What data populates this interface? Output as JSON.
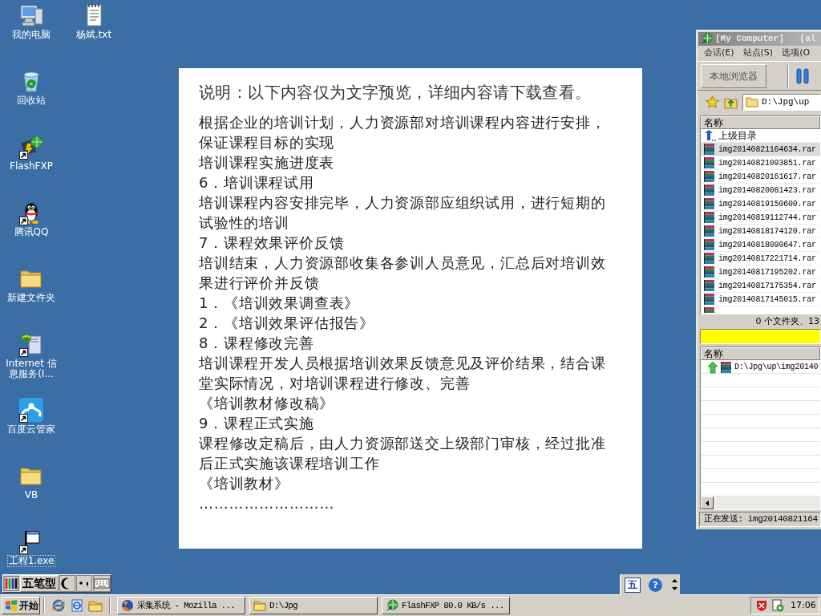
{
  "desktop": {
    "icons": [
      {
        "label": "我的电脑",
        "kind": "computer",
        "shortcut": false,
        "focused": false
      },
      {
        "label": "回收站",
        "kind": "recycle_bin",
        "shortcut": false,
        "focused": false
      },
      {
        "label": "FlashFXP",
        "kind": "ftp_app",
        "shortcut": true,
        "focused": false
      },
      {
        "label": "腾讯QQ",
        "kind": "qq",
        "shortcut": true,
        "focused": false
      },
      {
        "label": "新建文件夹",
        "kind": "folder",
        "shortcut": false,
        "focused": false
      },
      {
        "label": "Internet 信息服务(I...",
        "kind": "server",
        "shortcut": true,
        "focused": false
      },
      {
        "label": "百度云管家",
        "kind": "cloud",
        "shortcut": true,
        "focused": false
      },
      {
        "label": "VB",
        "kind": "folder",
        "shortcut": false,
        "focused": false
      },
      {
        "label": "工程1.exe",
        "kind": "program",
        "shortcut": true,
        "focused": true
      },
      {
        "label": "杨斌.txt",
        "kind": "text_file",
        "shortcut": false,
        "focused": false
      }
    ]
  },
  "document": {
    "notice": "说明：以下内容仅为文字预览，详细内容请下载查看。",
    "paragraphs": [
      "根据企业的培训计划，人力资源部对培训课程内容进行安排，保证课程目标的实现",
      "培训课程实施进度表",
      "6．培训课程试用",
      "培训课程内容安排完毕，人力资源部应组织试用，进行短期的试验性的培训",
      "7．课程效果评价反馈",
      "培训结束，人力资源部收集各参训人员意见，汇总后对培训效果进行评价并反馈",
      "1．《培训效果调查表》",
      "2．《培训效果评估报告》",
      "8．课程修改完善",
      "培训课程开发人员根据培训效果反馈意见及评价结果，结合课堂实际情况，对培训课程进行修改、完善",
      "《培训教材修改稿》",
      "9．课程正式实施",
      "课程修改定稿后，由人力资源部送交上级部门审核，经过批准后正式实施该课程培训工作",
      "《培训教材》",
      "………………………"
    ]
  },
  "ftp_window": {
    "title": "[My Computer]   [al",
    "menu": [
      "会话(E)",
      "站点(S)",
      "选项(O"
    ],
    "browser_button": "本地浏览器",
    "path": "D:\\Jpg\\up",
    "file_list": {
      "columns": [
        "名称"
      ],
      "rows": [
        {
          "name": "上级目录",
          "kind": "parent",
          "selected": false
        },
        {
          "name": "img20140821164634.rar",
          "kind": "rar",
          "selected": true
        },
        {
          "name": "img20140821093851.rar",
          "kind": "rar",
          "selected": false
        },
        {
          "name": "img20140820161617.rar",
          "kind": "rar",
          "selected": false
        },
        {
          "name": "img20140820081423.rar",
          "kind": "rar",
          "selected": false
        },
        {
          "name": "img20140819150600.rar",
          "kind": "rar",
          "selected": false
        },
        {
          "name": "img20140819112744.rar",
          "kind": "rar",
          "selected": false
        },
        {
          "name": "img20140818174120.rar",
          "kind": "rar",
          "selected": false
        },
        {
          "name": "img20140818090647.rar",
          "kind": "rar",
          "selected": false
        },
        {
          "name": "img20140817221714.rar",
          "kind": "rar",
          "selected": false
        },
        {
          "name": "img20140817195202.rar",
          "kind": "rar",
          "selected": false
        },
        {
          "name": "img20140817175354.rar",
          "kind": "rar",
          "selected": false
        },
        {
          "name": "img20140817145015.rar",
          "kind": "rar",
          "selected": false
        },
        {
          "kind": "rar",
          "selected": false
        }
      ]
    },
    "summary": "0 个文件夹、13",
    "queue": {
      "columns": [
        "名称"
      ],
      "rows": [
        {
          "name": "D:\\Jpg\\up\\img20140",
          "kind": "upload"
        }
      ]
    },
    "status": "正在发送: img20140821164"
  },
  "ime_bar": {
    "mode": "五笔型"
  },
  "language_bar": {
    "mode": "五",
    "help": "?"
  },
  "taskbar": {
    "start": "开始",
    "tasks": [
      {
        "label": "采集系统 - Mozilla ...",
        "kind": "browser",
        "selected": false
      },
      {
        "label": "D:\\Jpg",
        "kind": "folder",
        "selected": false
      },
      {
        "label": "FlashFXP 80.0 KB/s ...",
        "kind": "ftp",
        "selected": false
      }
    ],
    "clock": "17:06"
  }
}
